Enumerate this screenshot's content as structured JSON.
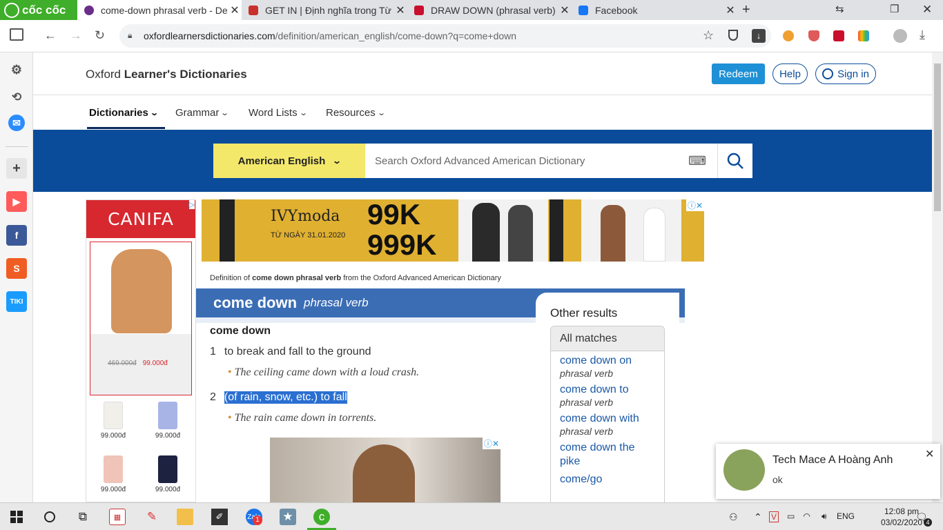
{
  "browser": {
    "brand": "cốc cốc",
    "tabs": [
      {
        "title": "come-down phrasal verb - De"
      },
      {
        "title": "GET IN | Định nghĩa trong Từ"
      },
      {
        "title": "DRAW DOWN (phrasal verb) c"
      },
      {
        "title": "Facebook"
      }
    ],
    "url_host": "oxfordlearnersdictionaries.com",
    "url_path": "/definition/american_english/come-down?q=come+down"
  },
  "site": {
    "brand_light": "Oxford ",
    "brand_bold": "Learner's Dictionaries",
    "redeem": "Redeem",
    "help": "Help",
    "signin": "Sign in",
    "menu": [
      "Dictionaries",
      "Grammar",
      "Word Lists",
      "Resources"
    ],
    "dict_select": "American English",
    "search_placeholder": "Search Oxford Advanced American Dictionary"
  },
  "ads": {
    "canifa_logo": "CANIFA",
    "canifa_old_price": "469.000đ",
    "canifa_new_price": "99.000đ",
    "canifa_thumb_price": "99.000đ",
    "ivy_brand": "IVYmoda",
    "ivy_date": "TỪ NGÀY 31.01.2020",
    "ivy_big1": "99K",
    "ivy_big2": "999K"
  },
  "entry": {
    "source_prefix": "Definition of ",
    "source_bold": "come down phrasal verb",
    "source_suffix": " from the Oxford Advanced American Dictionary",
    "headword": "come down",
    "pos": "phrasal verb",
    "sub_headword": "come down",
    "senses": [
      {
        "num": "1",
        "def": "to break and fall to the ground",
        "example": "The ceiling came down with a loud crash."
      },
      {
        "num": "2",
        "def": "(of rain, snow, etc.) to fall",
        "example": "The rain came down in torrents."
      }
    ]
  },
  "other_results": {
    "title": "Other results",
    "tab": "All matches",
    "items": [
      {
        "word": "come down on",
        "pos": "phrasal verb"
      },
      {
        "word": "come down to",
        "pos": "phrasal verb"
      },
      {
        "word": "come down with",
        "pos": "phrasal verb"
      },
      {
        "word": "come down the pike",
        "pos": ""
      },
      {
        "word": "come/go",
        "pos": ""
      }
    ]
  },
  "notification": {
    "name": "Tech Mace A Hoàng Anh",
    "message": "ok"
  },
  "taskbar": {
    "language": "ENG",
    "time": "12:08 pm",
    "date": "03/02/2020",
    "zalo_badge": "1",
    "notif_count": "4"
  },
  "colors": {
    "coccoc_green": "#3fae2a",
    "oxford_blue": "#0a4c9a",
    "entry_blue": "#3b6db5",
    "dict_yellow": "#f4e86a",
    "canifa_red": "#d7282f",
    "highlight": "#2a6fd1"
  }
}
